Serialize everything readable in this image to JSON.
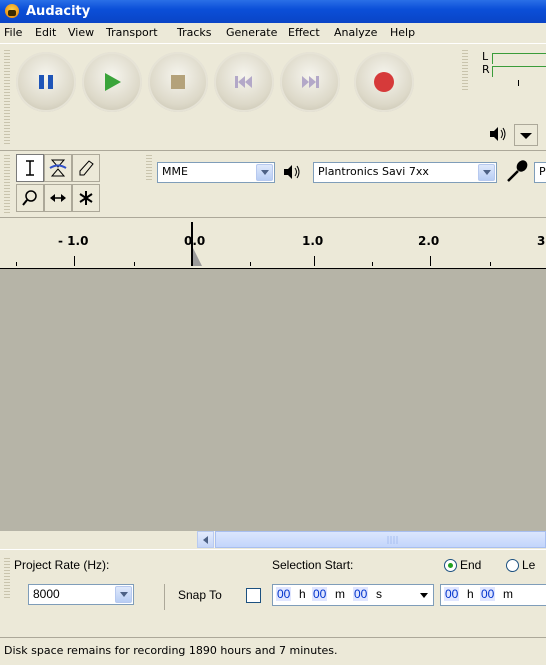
{
  "window": {
    "title": "Audacity"
  },
  "menu": [
    "File",
    "Edit",
    "View",
    "Transport",
    "Tracks",
    "Generate",
    "Effect",
    "Analyze",
    "Help"
  ],
  "meter": {
    "left_label": "L",
    "right_label": "R"
  },
  "device_toolbar": {
    "host": "MME",
    "playback_device": "Plantronics Savi 7xx",
    "recording_device_partial": "P"
  },
  "ruler": {
    "labels": [
      "- 1.0",
      "0.0",
      "1.0",
      "2.0",
      "3"
    ]
  },
  "selection_bar": {
    "project_rate_label": "Project Rate (Hz):",
    "project_rate_value": "8000",
    "snap_to_label": "Snap To",
    "selection_start_label": "Selection Start:",
    "end_label": "End",
    "length_label_partial": "Le",
    "start_time": {
      "h": "00",
      "h_unit": "h",
      "m": "00",
      "m_unit": "m",
      "s": "00",
      "s_unit": "s"
    },
    "end_time": {
      "h": "00",
      "h_unit": "h",
      "m": "00",
      "m_unit": "m"
    }
  },
  "status": {
    "text": "Disk space remains for recording 1890 hours and 7 minutes."
  },
  "colors": {
    "title_bar": "#0b4fd8",
    "track_area": "#b6b4a7",
    "play": "#3aa43a",
    "record": "#d63a3a",
    "pause": "#1f55b8"
  }
}
